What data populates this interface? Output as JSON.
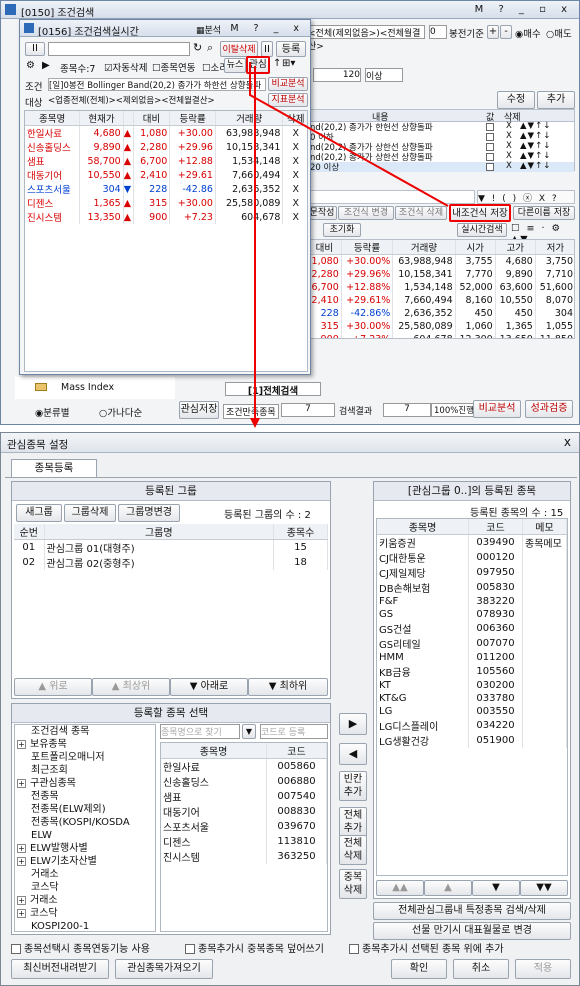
{
  "main": {
    "title": "[0150] 조건검색",
    "title_icons": [
      "M",
      "?",
      "_",
      "□",
      "x"
    ],
    "cond_text": "<전체(제외없음>)<전체월결산>",
    "rank_num": "0",
    "bong_label": "봉전기준",
    "buy_label": "매수",
    "sell_label": "매도",
    "edit_label": "수정",
    "add_label": "추가",
    "cond_num": "120",
    "cond_op": "이상",
    "cond_header_content": "내용",
    "cond_header_val": "값",
    "cond_header_del": "삭제",
    "cond_rows": [
      {
        "content": "nd(20,2) 종가가 한헌선 상향돌파",
        "del": "X"
      },
      {
        "content": "0 이하",
        "del": "X"
      },
      {
        "content": "nd(20,2) 종가가 상한선 상향돌파",
        "del": "X"
      },
      {
        "content": "nd(20,2) 종가가 상한선 상향돌파",
        "del": "X"
      },
      {
        "content": "20 이상",
        "del": "X"
      }
    ],
    "sym_row": "▼ ! ( ) ⓧ X ?",
    "tab_write": "문작성",
    "tab_change": "조건식 변경",
    "tab_del": "조건식 삭제",
    "tab_save": "내조건식 저장",
    "tab_rename": "다른이름 저장",
    "rt_search": "실시간검색",
    "reset": "초기화",
    "cols": [
      "대비",
      "등락률",
      "거래량",
      "시가",
      "고가",
      "저가"
    ],
    "rows": [
      {
        "d": "1,080",
        "r": "+30.00%",
        "v": "63,988,948",
        "o": "3,755",
        "h": "4,680",
        "l": "3,750"
      },
      {
        "d": "2,280",
        "r": "+29.96%",
        "v": "10,158,341",
        "o": "7,770",
        "h": "9,890",
        "l": "7,710"
      },
      {
        "d": "6,700",
        "r": "+12.88%",
        "v": "1,534,148",
        "o": "52,000",
        "h": "63,600",
        "l": "51,600"
      },
      {
        "d": "2,410",
        "r": "+29.61%",
        "v": "7,660,494",
        "o": "8,160",
        "h": "10,550",
        "l": "8,070"
      },
      {
        "d": "228",
        "r": "-42.86%",
        "v": "2,636,352",
        "o": "450",
        "h": "450",
        "l": "304"
      },
      {
        "d": "315",
        "r": "+30.00%",
        "v": "25,580,089",
        "o": "1,060",
        "h": "1,365",
        "l": "1,055"
      },
      {
        "d": "900",
        "r": "+7.23%",
        "v": "604,678",
        "o": "12,300",
        "h": "13,650",
        "l": "11,850"
      }
    ],
    "tree_item": "Mass Index",
    "radio1": "분류별",
    "radio2": "가나다순",
    "bottom_tab": "[1]전체검색",
    "save_cond": "관심저장",
    "cond_result_label": "조건만족종목",
    "cond_result": "7",
    "search_result_label": "검색결과",
    "search_result": "7",
    "progress": "100%진행",
    "compare": "비교분석",
    "perf": "성과검증"
  },
  "rt": {
    "title": "[0156] 조건검색실시간",
    "analyze": "분석",
    "icons": [
      "M",
      "?",
      "_",
      "x"
    ],
    "exit_monitor": "이탈삭제",
    "reg": "등록",
    "count_label": "종목수:",
    "count": "7",
    "auto_del": "자동삭제",
    "link": "종목연동",
    "sound": "소리",
    "news": "뉴스",
    "interest": "관심",
    "cond_label": "조건",
    "cond_text": "[일]0봉전 Bollinger Band(20,2) 종가가 하한선 상향돌파",
    "compare": "비교분석",
    "target_label": "대상",
    "target_text": "<업종전체(전체)><제외없음><전체월결산>",
    "indicator": "지표분석",
    "cols": [
      "종목명",
      "현재가",
      "대비",
      "등락률",
      "거래량",
      "삭제"
    ],
    "rows": [
      {
        "n": "한일사료",
        "p": "4,680",
        "s": "up",
        "d": "1,080",
        "r": "+30.00",
        "v": "63,988,948",
        "x": "X"
      },
      {
        "n": "신송홀딩스",
        "p": "9,890",
        "s": "up",
        "d": "2,280",
        "r": "+29.96",
        "v": "10,158,341",
        "x": "X"
      },
      {
        "n": "샘표",
        "p": "58,700",
        "s": "up",
        "d": "6,700",
        "r": "+12.88",
        "v": "1,534,148",
        "x": "X"
      },
      {
        "n": "대동기어",
        "p": "10,550",
        "s": "up",
        "d": "2,410",
        "r": "+29.61",
        "v": "7,660,494",
        "x": "X"
      },
      {
        "n": "스포츠서울",
        "p": "304",
        "s": "down",
        "d": "228",
        "r": "-42.86",
        "v": "2,636,352",
        "x": "X"
      },
      {
        "n": "디젠스",
        "p": "1,365",
        "s": "up",
        "d": "315",
        "r": "+30.00",
        "v": "25,580,089",
        "x": "X"
      },
      {
        "n": "진시스템",
        "p": "13,350",
        "s": "up",
        "d": "900",
        "r": "+7.23",
        "v": "604,678",
        "x": "X"
      }
    ]
  },
  "dlg": {
    "title": "관심종목 설정",
    "tab": "종목등록",
    "reg_group_head": "등록된 그룹",
    "new_group": "새그룹",
    "del_group": "그룹삭제",
    "rename_group": "그룹명변경",
    "group_count_label": "등록된 그룹의 수 : 2",
    "group_cols": [
      "순번",
      "그룹명",
      "종목수"
    ],
    "groups": [
      {
        "no": "01",
        "name": "관심그룹 01(대형주)",
        "cnt": "15"
      },
      {
        "no": "02",
        "name": "관심그룹 02(중형주)",
        "cnt": "18"
      }
    ],
    "up": "▲ 위로",
    "top": "▲ 최상위",
    "down": "▼ 아래로",
    "bottom": "▼ 최하위",
    "right_head": "[관심그룹 0..]의 등록된 종목",
    "right_count": "등록된 종목의 수 : 15",
    "right_cols": [
      "종목명",
      "코드",
      "메모"
    ],
    "right_rows": [
      {
        "n": "키움증권",
        "c": "039490",
        "m": "종목메모"
      },
      {
        "n": "CJ대한통운",
        "c": "000120",
        "m": ""
      },
      {
        "n": "CJ제일제당",
        "c": "097950",
        "m": ""
      },
      {
        "n": "DB손해보험",
        "c": "005830",
        "m": ""
      },
      {
        "n": "F&F",
        "c": "383220",
        "m": ""
      },
      {
        "n": "GS",
        "c": "078930",
        "m": ""
      },
      {
        "n": "GS건설",
        "c": "006360",
        "m": ""
      },
      {
        "n": "GS리테일",
        "c": "007070",
        "m": ""
      },
      {
        "n": "HMM",
        "c": "011200",
        "m": ""
      },
      {
        "n": "KB금융",
        "c": "105560",
        "m": ""
      },
      {
        "n": "KT",
        "c": "030200",
        "m": ""
      },
      {
        "n": "KT&G",
        "c": "033780",
        "m": ""
      },
      {
        "n": "LG",
        "c": "003550",
        "m": ""
      },
      {
        "n": "LG디스플레이",
        "c": "034220",
        "m": ""
      },
      {
        "n": "LG생활건강",
        "c": "051900",
        "m": ""
      }
    ],
    "sel_head": "등록할 종목 선택",
    "tree": [
      "조건검색 종목",
      "보유종목",
      "포트폴리오매니저",
      "최근조회",
      "구관심종목",
      "전종목",
      "전종목(ELW제외)",
      "전종목(KOSPI/KOSDA",
      "ELW",
      "ELW발행사별",
      "ELW기초자산별",
      "거래소",
      "코스닥",
      "거래소",
      "코스닥",
      "KOSPI200-1"
    ],
    "search_name_ph": "종목명으로 찾기",
    "search_code_ph": "코드로 등록",
    "mid_cols": [
      "종목명",
      "코드"
    ],
    "mid_rows": [
      {
        "n": "한일사료",
        "c": "005860"
      },
      {
        "n": "신송홀딩스",
        "c": "006880"
      },
      {
        "n": "샘표",
        "c": "007540"
      },
      {
        "n": "대동기어",
        "c": "008830"
      },
      {
        "n": "스포츠서울",
        "c": "039670"
      },
      {
        "n": "디젠스",
        "c": "113810"
      },
      {
        "n": "진시스템",
        "c": "363250"
      }
    ],
    "arrow_right": "▶",
    "arrow_left": "◀",
    "add_blank": "빈칸\n추가",
    "add_all": "전체\n추가",
    "del_all": "전체\n삭제",
    "del_dup": "중복\n삭제",
    "r_up2": "▲▲",
    "r_up": "▲",
    "r_down": "▼",
    "r_down2": "▼▼",
    "search_specific": "전체관심그룹내 특정종목 검색/삭제",
    "maturity": "선물 만기시 대표월물로 변경",
    "opt1": "종목선택시 종목연동기능 사용",
    "opt2": "종목추가시 중복종목 덮어쓰기",
    "opt3": "종목추가시 선택된 종목 위에 추가",
    "latest": "최신버전내려받기",
    "import": "관심종목가져오기",
    "ok": "확인",
    "cancel": "취소",
    "apply": "적용"
  },
  "colors": {
    "accent_red": "#e00000",
    "up": "#d80000",
    "down": "#0040d0",
    "title_bar": "#dfe6f0"
  }
}
